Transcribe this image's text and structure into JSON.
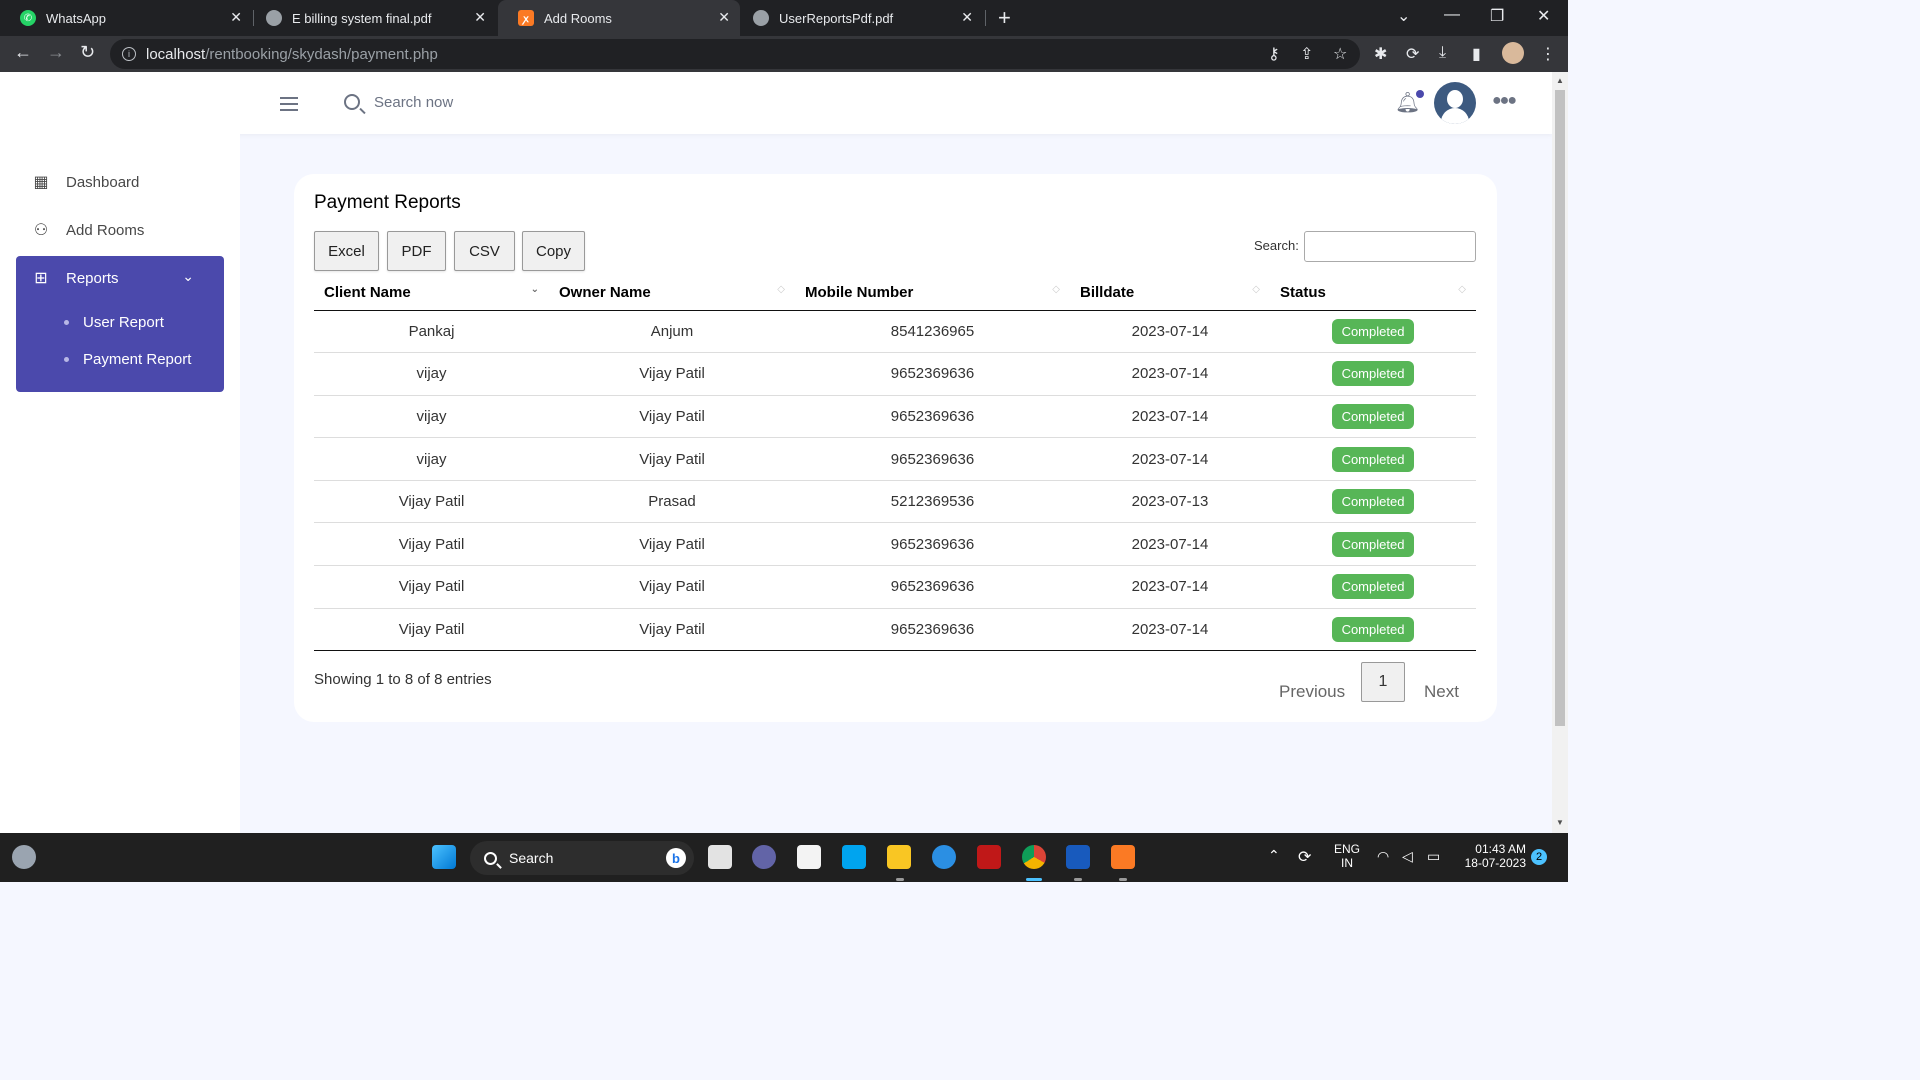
{
  "browser": {
    "tabs": [
      {
        "title": "WhatsApp",
        "icon": "whatsapp-icon",
        "color": "#25d366"
      },
      {
        "title": "E billing system final.pdf",
        "icon": "globe-icon",
        "color": "#9aa0a6"
      },
      {
        "title": "Add Rooms",
        "icon": "xampp-icon",
        "color": "#fb7a24"
      },
      {
        "title": "UserReportsPdf.pdf",
        "icon": "globe-icon",
        "color": "#9aa0a6"
      }
    ],
    "url_host": "localhost",
    "url_path": "/rentbooking/skydash/payment.php"
  },
  "topnav": {
    "search_placeholder": "Search now"
  },
  "sidebar": {
    "items": [
      {
        "label": "Dashboard",
        "icon": "grid-icon"
      },
      {
        "label": "Add Rooms",
        "icon": "user-icon"
      }
    ],
    "reports": {
      "label": "Reports",
      "icon": "layout-icon",
      "subitems": [
        "User Report",
        "Payment Report"
      ]
    }
  },
  "card": {
    "title": "Payment Reports",
    "buttons": [
      "Excel",
      "PDF",
      "CSV",
      "Copy"
    ],
    "search_label": "Search:",
    "columns": [
      "Client Name",
      "Owner Name",
      "Mobile Number",
      "Billdate",
      "Status"
    ],
    "rows": [
      [
        "Pankaj",
        "Anjum",
        "8541236965",
        "2023-07-14",
        "Completed"
      ],
      [
        "vijay",
        "Vijay Patil",
        "9652369636",
        "2023-07-14",
        "Completed"
      ],
      [
        "vijay",
        "Vijay Patil",
        "9652369636",
        "2023-07-14",
        "Completed"
      ],
      [
        "vijay",
        "Vijay Patil",
        "9652369636",
        "2023-07-14",
        "Completed"
      ],
      [
        "Vijay Patil",
        "Prasad",
        "5212369536",
        "2023-07-13",
        "Completed"
      ],
      [
        "Vijay Patil",
        "Vijay Patil",
        "9652369636",
        "2023-07-14",
        "Completed"
      ],
      [
        "Vijay Patil",
        "Vijay Patil",
        "9652369636",
        "2023-07-14",
        "Completed"
      ],
      [
        "Vijay Patil",
        "Vijay Patil",
        "9652369636",
        "2023-07-14",
        "Completed"
      ]
    ],
    "info": "Showing 1 to 8 of 8 entries",
    "pagination": {
      "previous": "Previous",
      "current": "1",
      "next": "Next"
    }
  },
  "taskbar": {
    "search_label": "Search",
    "lang_top": "ENG",
    "lang_bottom": "IN",
    "time": "01:43 AM",
    "date": "18-07-2023",
    "notification_count": "2"
  },
  "colors": {
    "accent": "#4b49ac",
    "status_completed": "#57b657"
  }
}
